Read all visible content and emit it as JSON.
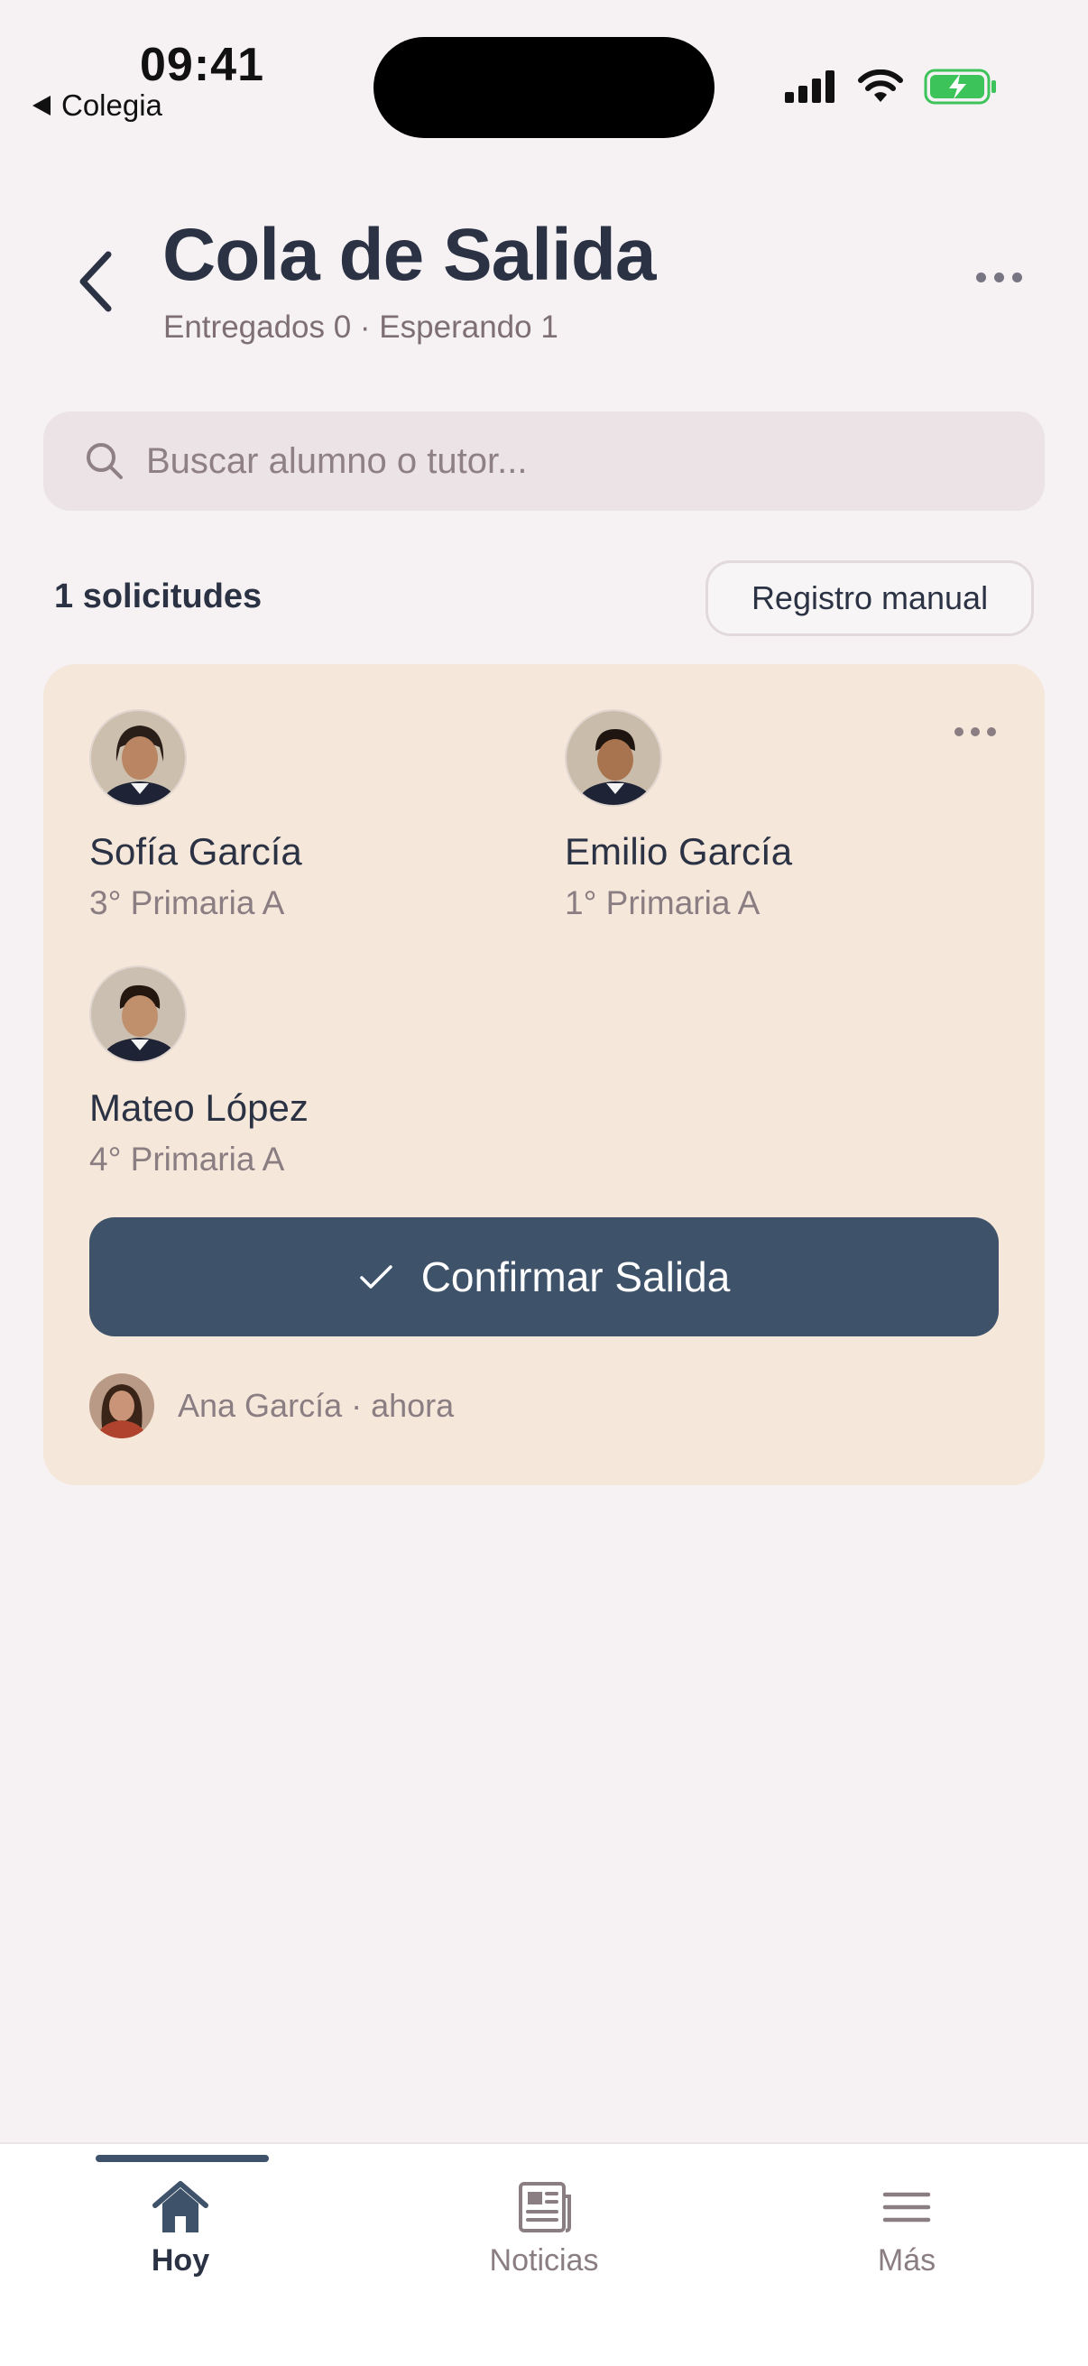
{
  "status_bar": {
    "time": "09:41",
    "back_app": "Colegia"
  },
  "header": {
    "title": "Cola de Salida",
    "subtitle": "Entregados 0 · Esperando 1"
  },
  "search": {
    "placeholder": "Buscar alumno o tutor..."
  },
  "list": {
    "count_label": "1 solicitudes",
    "manual_button": "Registro manual"
  },
  "request_card": {
    "students": [
      {
        "name": "Sofía García",
        "grade": "3° Primaria A"
      },
      {
        "name": "Emilio García",
        "grade": "1° Primaria A"
      },
      {
        "name": "Mateo López",
        "grade": "4° Primaria A"
      }
    ],
    "confirm_label": "Confirmar Salida",
    "tutor_line": "Ana García · ahora"
  },
  "tabbar": {
    "tabs": [
      {
        "label": "Hoy",
        "icon": "home-icon",
        "active": true
      },
      {
        "label": "Noticias",
        "icon": "newspaper-icon",
        "active": false
      },
      {
        "label": "Más",
        "icon": "menu-icon",
        "active": false
      }
    ]
  },
  "colors": {
    "accent": "#3e526a",
    "card_bg": "#f5e7da",
    "page_bg": "#f6f2f3"
  }
}
